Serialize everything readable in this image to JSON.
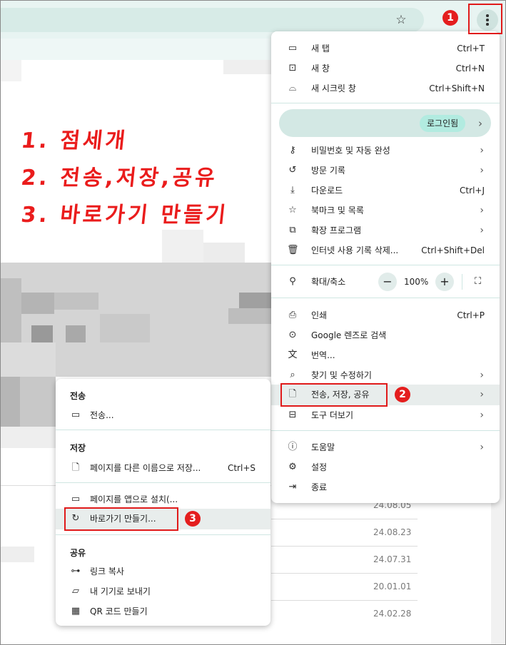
{
  "annotations": {
    "badge1": "1",
    "badge2": "2",
    "badge3": "3",
    "notes": [
      "1. 점세개",
      "2. 전송,저장,공유",
      "3. 바로가기 만들기"
    ]
  },
  "background": {
    "dates": [
      "24.08.05",
      "24.08.23",
      "24.07.31",
      "20.01.01",
      "24.02.28"
    ]
  },
  "menu": {
    "new_tab": {
      "label": "새 탭",
      "shortcut": "Ctrl+T"
    },
    "new_window": {
      "label": "새 창",
      "shortcut": "Ctrl+N"
    },
    "incognito": {
      "label": "새 시크릿 창",
      "shortcut": "Ctrl+Shift+N"
    },
    "profile_chip": "로그인됨",
    "passwords": "비밀번호 및 자동 완성",
    "history": "방문 기록",
    "downloads": {
      "label": "다운로드",
      "shortcut": "Ctrl+J"
    },
    "bookmarks": "북마크 및 목록",
    "extensions": "확장 프로그램",
    "clear_data": {
      "label": "인터넷 사용 기록 삭제...",
      "shortcut": "Ctrl+Shift+Del"
    },
    "zoom": {
      "label": "확대/축소",
      "minus": "−",
      "value": "100%",
      "plus": "+"
    },
    "print": {
      "label": "인쇄",
      "shortcut": "Ctrl+P"
    },
    "lens": "Google 렌즈로 검색",
    "translate": "번역...",
    "find": "찾기 및 수정하기",
    "cast_save_share": "전송, 저장, 공유",
    "more_tools": "도구 더보기",
    "help": "도움말",
    "settings": "설정",
    "exit": "종료"
  },
  "submenu": {
    "cast_header": "전송",
    "cast": "전송...",
    "save_header": "저장",
    "save_page": {
      "label": "페이지를 다른 이름으로 저장...",
      "shortcut": "Ctrl+S"
    },
    "install_app": "페이지를 앱으로 설치(...",
    "create_shortcut": "바로가기 만들기...",
    "share_header": "공유",
    "copy_link": "링크 복사",
    "send_devices": "내 기기로 보내기",
    "qr_code": "QR 코드 만들기"
  }
}
